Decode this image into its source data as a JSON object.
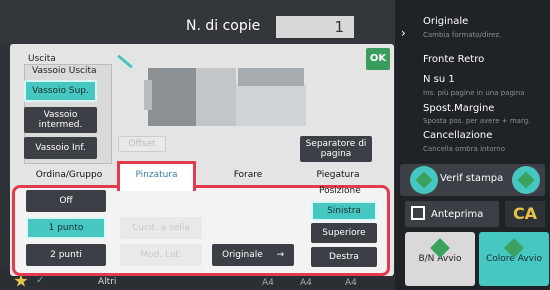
{
  "header": {
    "copies_label": "N. di copie",
    "copies_value": "1"
  },
  "dialog": {
    "ok_label": "OK",
    "output_title": "Uscita",
    "tray_title": "Vassoio Uscita",
    "trays": [
      {
        "label": "Vassoio Sup.",
        "selected": true
      },
      {
        "label": "Vassoio intermed.",
        "selected": false
      },
      {
        "label": "Vassoio Inf.",
        "selected": false
      }
    ],
    "offset_label": "Offset",
    "separator_label": "Separatore di pagina",
    "tabs": [
      "Ordina/Gruppo",
      "Pinzatura",
      "Forare",
      "Piegatura"
    ],
    "active_tab": "Pinzatura",
    "staple_options": [
      {
        "label": "Off",
        "selected": false
      },
      {
        "label": "1 punto",
        "selected": true
      },
      {
        "label": "2 punti",
        "selected": false
      }
    ],
    "ghost_btn_1": "Cucit. a sella",
    "ghost_btn_2": "Mod. Lot.",
    "original_label": "Originale",
    "position_title": "Posizione",
    "positions": [
      {
        "label": "Sinistra",
        "selected": true
      },
      {
        "label": "Superiore",
        "selected": false
      },
      {
        "label": "Destra",
        "selected": false
      }
    ]
  },
  "bottom": {
    "altri": "Altri",
    "a4_1": "A4",
    "a4_2": "A4",
    "a4_3": "A4"
  },
  "right_panel": {
    "items": [
      {
        "title": "Originale",
        "sub": "Cambia formato/direz."
      },
      {
        "title": "Fronte Retro",
        "sub": ""
      },
      {
        "title": "N su 1",
        "sub": "Ins. più pagine in una pagina"
      },
      {
        "title": "Spost.Margine",
        "sub": "Sposta pos. per avere + marg."
      },
      {
        "title": "Cancellazione",
        "sub": "Cancella ombra intorno"
      }
    ],
    "verif_label": "Verif stampa",
    "preview_label": "Anteprima",
    "ca_label": "CA",
    "bw_label": "B/N Avvio",
    "color_label": "Colore Avvio"
  },
  "colors": {
    "accent": "#47c7c2",
    "highlight": "#e23a4f",
    "ok": "#3a9d5d"
  }
}
